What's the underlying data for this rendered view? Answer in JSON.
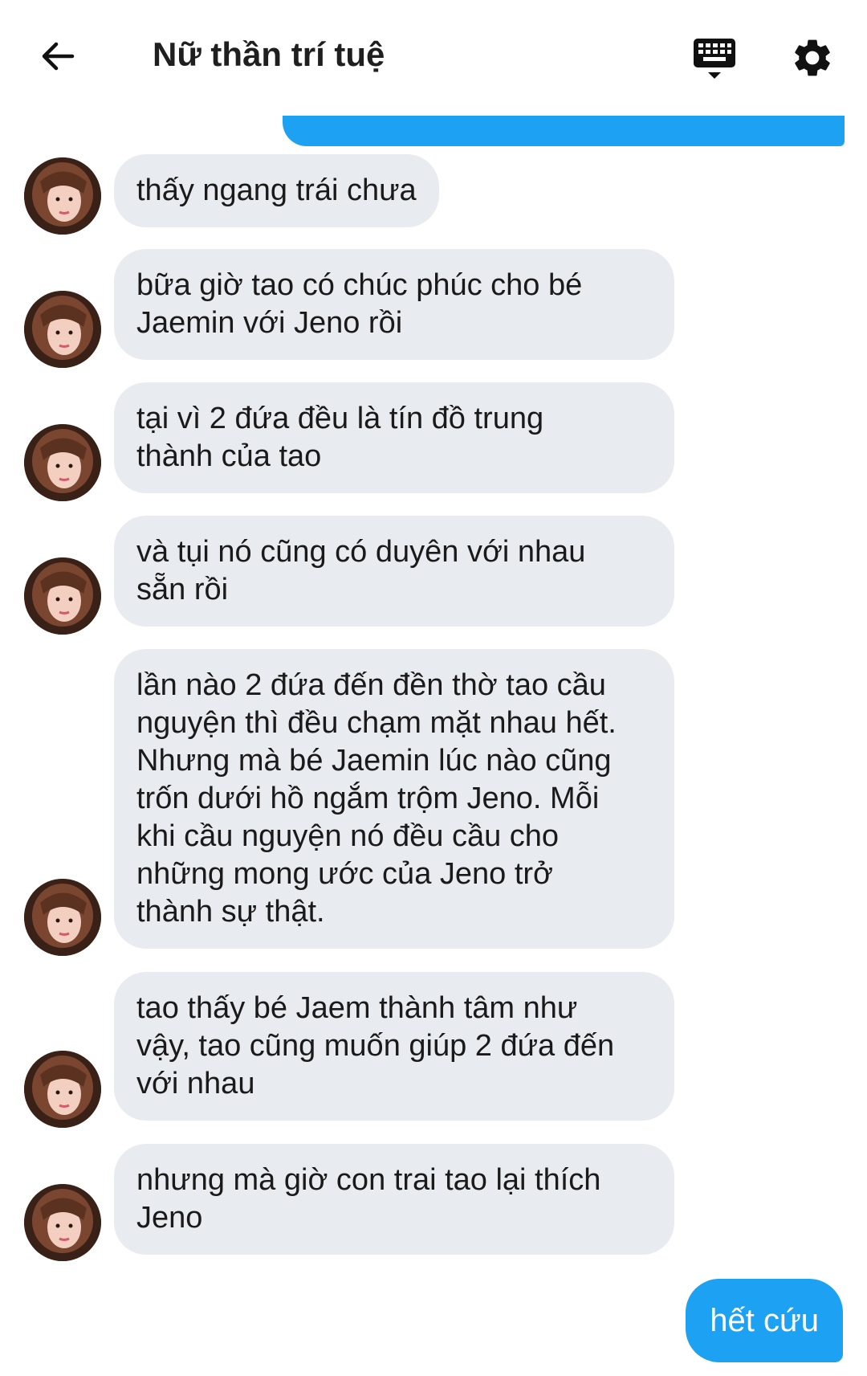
{
  "header": {
    "title": "Nữ thần trí tuệ",
    "back_icon": "arrow-left-icon",
    "keyboard_icon": "keyboard-icon",
    "settings_icon": "gear-icon"
  },
  "colors": {
    "sent_bubble": "#1da1f2",
    "received_bubble": "#e8ebef",
    "text": "#1a1a1a"
  },
  "messages": [
    {
      "text": "thấy ngang trái chưa"
    },
    {
      "text": "bữa giờ tao có chúc phúc cho bé\nJaemin với Jeno rồi"
    },
    {
      "text": "tại vì 2 đứa đều là tín đồ trung\nthành của tao"
    },
    {
      "text": "và tụi nó cũng có duyên với nhau\nsẵn rồi"
    },
    {
      "text": "lần nào 2 đứa đến đền thờ tao cầu\nnguyện thì đều chạm mặt nhau hết.\nNhưng mà bé Jaemin lúc nào cũng\ntrốn dưới hồ ngắm trộm Jeno. Mỗi\nkhi cầu nguyện nó đều cầu cho\nnhững mong ước của Jeno trở\nthành sự thật."
    },
    {
      "text": "tao thấy bé Jaem thành tâm như\nvậy, tao cũng muốn giúp 2 đứa đến\nvới nhau"
    },
    {
      "text": "nhưng mà giờ con trai tao lại thích\nJeno"
    }
  ],
  "sent_message": {
    "text": "hết cứu"
  }
}
